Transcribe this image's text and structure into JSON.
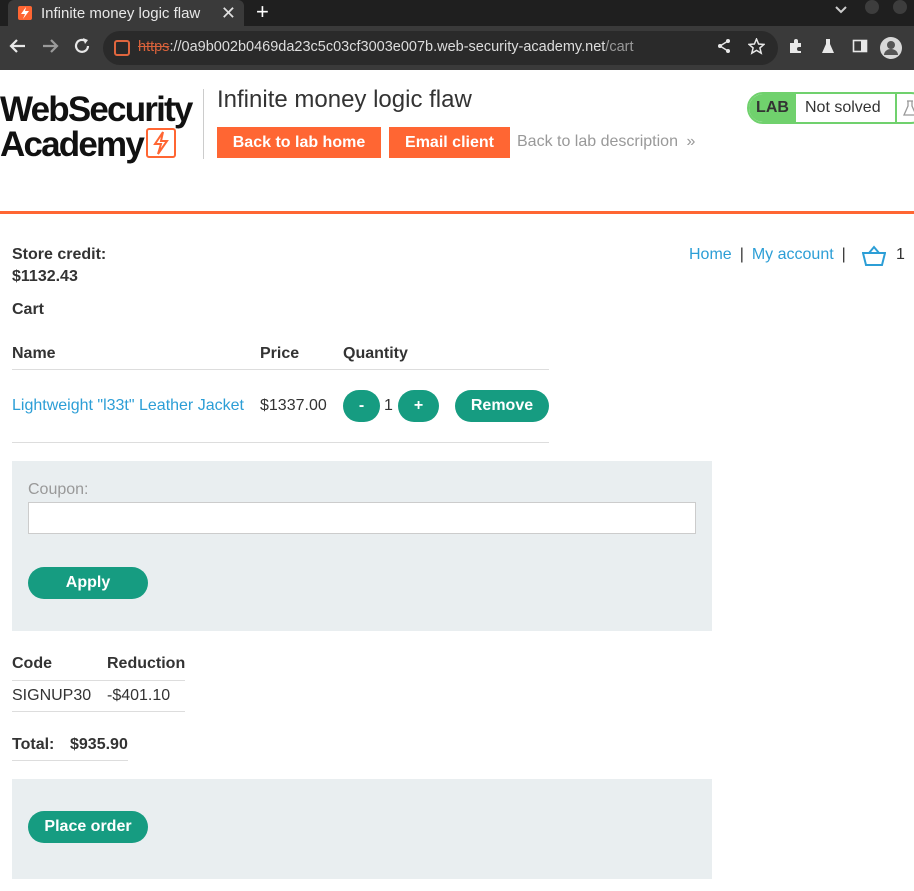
{
  "browser": {
    "tab_title": "Infinite money logic flaw",
    "close_glyph": "✕",
    "newtab_glyph": "+",
    "menu_glyph": "⌄",
    "url_scheme": "https",
    "url_host": "://0a9b002b0469da23c5c03cf3003e007b.web-security-academy.net",
    "url_path": "/cart"
  },
  "header": {
    "logo_line1": "WebSecurity",
    "logo_line2": "Academy",
    "lab_title": "Infinite money logic flaw",
    "back_to_lab_home": "Back to lab home",
    "email_client": "Email client",
    "back_to_lab_description": "Back to lab description",
    "desc_chevron": "»",
    "lab_tag": "LAB",
    "lab_state": "Not solved"
  },
  "nav": {
    "home": "Home",
    "separator": "|",
    "my_account": "My account",
    "cart_count": "1"
  },
  "credit": {
    "label": "Store credit:",
    "value": "$1132.43"
  },
  "cart": {
    "heading": "Cart",
    "columns": [
      "Name",
      "Price",
      "Quantity"
    ],
    "item": {
      "name": "Lightweight \"l33t\" Leather Jacket",
      "price": "$1337.00",
      "quantity": "1",
      "decrement": "-",
      "increment": "+",
      "remove": "Remove"
    }
  },
  "coupon": {
    "label": "Coupon:",
    "value": "",
    "apply": "Apply"
  },
  "discounts": {
    "columns": [
      "Code",
      "Reduction"
    ],
    "rows": [
      {
        "code": "SIGNUP30",
        "reduction": "-$401.10"
      }
    ]
  },
  "total": {
    "label": "Total:",
    "value": "$935.90"
  },
  "place_order": "Place order",
  "colors": {
    "brand_orange": "#ff6633",
    "action_green": "#169c81",
    "link_blue": "#2c9ed6",
    "status_green": "#70d16d"
  }
}
